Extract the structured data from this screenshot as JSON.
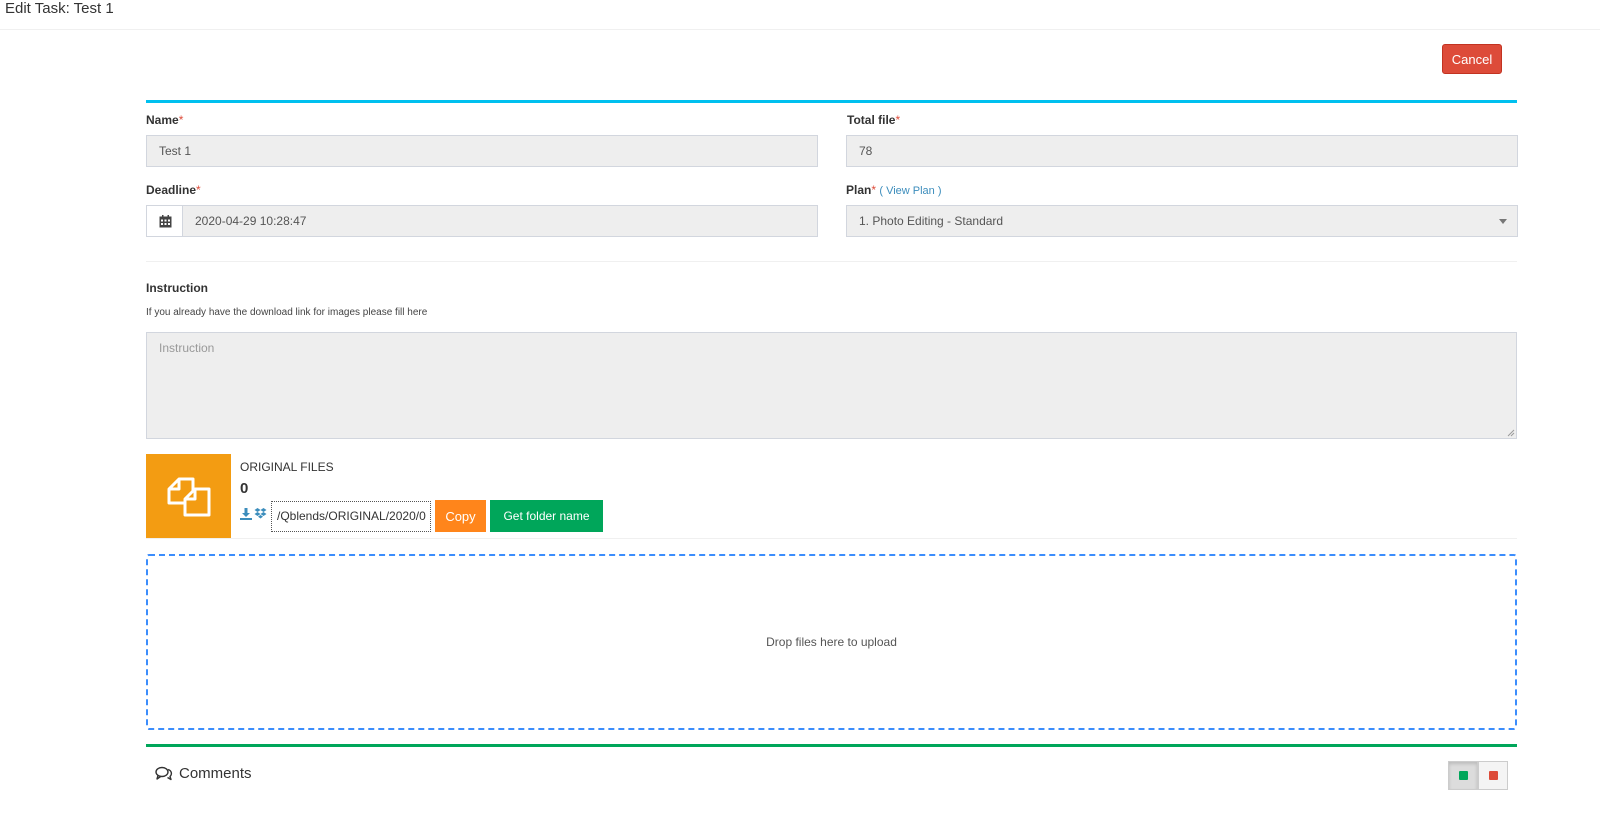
{
  "header": {
    "title": "Edit Task: Test 1"
  },
  "actions": {
    "cancel_label": "Cancel"
  },
  "form": {
    "name": {
      "label": "Name",
      "required_mark": "*",
      "value": "Test 1"
    },
    "total_file": {
      "label": "Total file",
      "required_mark": "*",
      "value": "78"
    },
    "deadline": {
      "label": "Deadline",
      "required_mark": "*",
      "value": "2020-04-29 10:28:47",
      "icon": "calendar-icon"
    },
    "plan": {
      "label": "Plan",
      "required_mark": "*",
      "view_plan_link": "( View Plan )",
      "selected": "1. Photo Editing - Standard"
    },
    "instruction": {
      "label": "Instruction",
      "help": "If you already have the download link for images please fill here",
      "placeholder": "Instruction"
    }
  },
  "original_files": {
    "title": "ORIGINAL FILES",
    "count": "0",
    "path": "/Qblends/ORIGINAL/2020/0",
    "copy_label": "Copy",
    "folder_label": "Get folder name",
    "color": "#f39c12"
  },
  "dropzone": {
    "text": "Drop files here to upload"
  },
  "comments": {
    "title": "Comments"
  },
  "colors": {
    "accent": "#00c0ef",
    "danger": "#dd4b39",
    "success": "#00a65a",
    "warning": "#ff851b"
  }
}
